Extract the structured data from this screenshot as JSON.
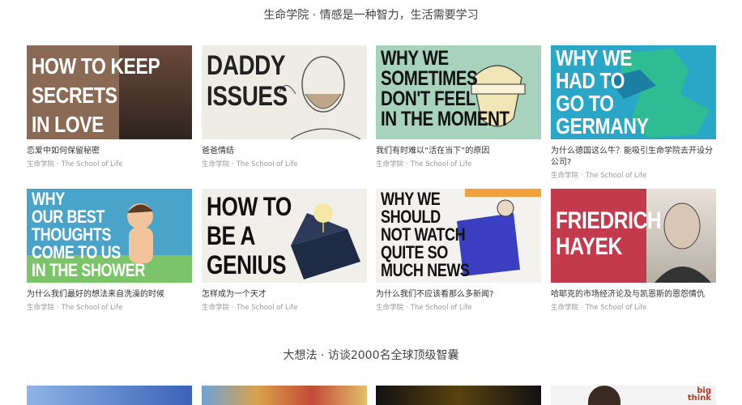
{
  "sections": [
    {
      "title": "生命学院 · 情感是一种智力，生活需要学习"
    },
    {
      "title": "大想法 · 访谈2000名全球顶级智囊"
    }
  ],
  "cards": [
    {
      "thumb_text": "HOW TO KEEP\nSECRETS\nIN LOVE",
      "bg": "#8a6a54",
      "fg": "#ffffff",
      "caption": "恋爱中如何保留秘密",
      "source": "生命学院",
      "channel": "The School of Life"
    },
    {
      "thumb_text": "DADDY\nISSUES",
      "bg": "#efece6",
      "fg": "#222222",
      "caption": "爸爸情结",
      "source": "生命学院",
      "channel": "The School of Life"
    },
    {
      "thumb_text": "WHY WE\nSOMETIMES\nDON'T FEEL\nIN THE MOMENT",
      "bg": "#a7d3bd",
      "fg": "#111111",
      "caption": "我们有时难以“活在当下”的原因",
      "source": "生命学院",
      "channel": "The School of Life"
    },
    {
      "thumb_text": "WHY WE\nHAD TO\nGO TO\nGERMANY",
      "bg": "#2aa7c7",
      "fg": "#ffffff",
      "caption": "为什么德国这么牛？能吸引生命学院去开设分公司?",
      "source": "生命学院",
      "channel": "The School of Life"
    },
    {
      "thumb_text": "WHY\nOUR BEST\nTHOUGHTS\nCOME TO US\nIN THE SHOWER",
      "bg": "#4aa3c9",
      "fg": "#ffffff",
      "caption": "为什么我们最好的想法来自洗澡的时候",
      "source": "生命学院",
      "channel": "The School of Life"
    },
    {
      "thumb_text": "HOW TO\nBE A\nGENIUS",
      "bg": "#f1efe9",
      "fg": "#111111",
      "caption": "怎样成为一个天才",
      "source": "生命学院",
      "channel": "The School of Life"
    },
    {
      "thumb_text": "WHY WE\nSHOULD\nNOT WATCH\nQUITE SO\nMUCH NEWS",
      "bg": "#f4f2ee",
      "fg": "#111111",
      "caption": "为什么我们不应该看那么多新闻?",
      "source": "生命学院",
      "channel": "The School of Life"
    },
    {
      "thumb_text": "FRIEDRICH\nHAYEK",
      "bg": "#c23a4c",
      "fg": "#ffffff",
      "caption": "哈耶克的市场经济论及与凯恩斯的恩怨情仇",
      "source": "生命学院",
      "channel": "The School of Life"
    }
  ],
  "bottom_thumbs": [
    {
      "bg": "#3a63b8",
      "label": ""
    },
    {
      "bg": "#c9a35a",
      "label": ""
    },
    {
      "bg": "#1d1d1d",
      "label": ""
    },
    {
      "bg": "#f3f3f3",
      "label": "big\nthink"
    }
  ]
}
